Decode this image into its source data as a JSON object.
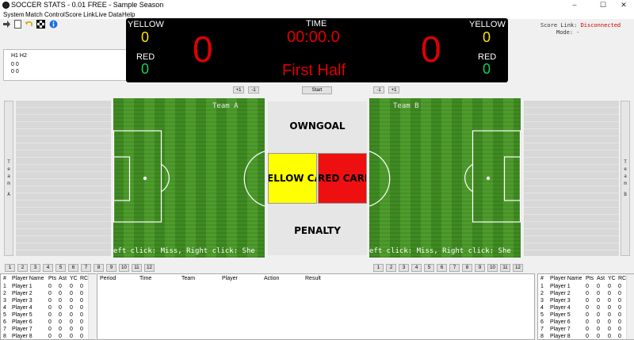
{
  "window": {
    "title": "SOCCER STATS - 0.01 FREE - Sample Season",
    "min": "–",
    "max": "☐",
    "close": "✕"
  },
  "menu": [
    "System",
    "Match Control",
    "Score Link",
    "Live Data",
    "Help"
  ],
  "halves": {
    "header": "H1  H2",
    "row1": "0    0",
    "row2": "0    0"
  },
  "scoreboard": {
    "home": {
      "yellow_label": "YELLOW",
      "yellow": "0",
      "red_label": "RED",
      "red": "0",
      "score": "0"
    },
    "away": {
      "yellow_label": "YELLOW",
      "yellow": "0",
      "red_label": "RED",
      "red": "0",
      "score": "0"
    },
    "time_label": "TIME",
    "time": "00:00.0",
    "period": "First Half"
  },
  "score_link": {
    "label": "Score Link:",
    "status": "Disconnected",
    "mode_label": "Mode:",
    "mode": "-"
  },
  "controls": {
    "plus1": "+1",
    "minus1": "-1",
    "start": "Start"
  },
  "fields": {
    "home_team": "Team A",
    "away_team": "Team B",
    "hint_home": "eft click: Miss, Right click: She",
    "hint_away": "eft click: Miss, Right click: She"
  },
  "side": {
    "home_vertical": [
      "T",
      "e",
      "a",
      "m",
      "",
      "A"
    ],
    "away_vertical": [
      "T",
      "e",
      "a",
      "m",
      "",
      "B"
    ]
  },
  "center_buttons": {
    "owngoal": "OWNGOAL",
    "yellow_card": "ELLOW CAR",
    "red_card": "RED CARD",
    "penalty": "PENALTY"
  },
  "number_buttons": [
    "1",
    "2",
    "3",
    "4",
    "5",
    "6",
    "7",
    "8",
    "9",
    "10",
    "11",
    "12"
  ],
  "player_columns": [
    "#",
    "Player Name",
    "Pts",
    "Ast",
    "YC",
    "RC"
  ],
  "home_players": [
    {
      "n": "1",
      "name": "Player 1",
      "pts": "0",
      "ast": "0",
      "yc": "0",
      "rc": "0"
    },
    {
      "n": "2",
      "name": "Player 2",
      "pts": "0",
      "ast": "0",
      "yc": "0",
      "rc": "0"
    },
    {
      "n": "3",
      "name": "Player 3",
      "pts": "0",
      "ast": "0",
      "yc": "0",
      "rc": "0"
    },
    {
      "n": "4",
      "name": "Player 4",
      "pts": "0",
      "ast": "0",
      "yc": "0",
      "rc": "0"
    },
    {
      "n": "5",
      "name": "Player 5",
      "pts": "0",
      "ast": "0",
      "yc": "0",
      "rc": "0"
    },
    {
      "n": "6",
      "name": "Player 6",
      "pts": "0",
      "ast": "0",
      "yc": "0",
      "rc": "0"
    },
    {
      "n": "7",
      "name": "Player 7",
      "pts": "0",
      "ast": "0",
      "yc": "0",
      "rc": "0"
    },
    {
      "n": "8",
      "name": "Player 8",
      "pts": "0",
      "ast": "0",
      "yc": "0",
      "rc": "0"
    }
  ],
  "away_players": [
    {
      "n": "1",
      "name": "Player 1",
      "pts": "0",
      "ast": "0",
      "yc": "0",
      "rc": "0"
    },
    {
      "n": "2",
      "name": "Player 2",
      "pts": "0",
      "ast": "0",
      "yc": "0",
      "rc": "0"
    },
    {
      "n": "3",
      "name": "Player 3",
      "pts": "0",
      "ast": "0",
      "yc": "0",
      "rc": "0"
    },
    {
      "n": "4",
      "name": "Player 4",
      "pts": "0",
      "ast": "0",
      "yc": "0",
      "rc": "0"
    },
    {
      "n": "5",
      "name": "Player 5",
      "pts": "0",
      "ast": "0",
      "yc": "0",
      "rc": "0"
    },
    {
      "n": "6",
      "name": "Player 6",
      "pts": "0",
      "ast": "0",
      "yc": "0",
      "rc": "0"
    },
    {
      "n": "7",
      "name": "Player 7",
      "pts": "0",
      "ast": "0",
      "yc": "0",
      "rc": "0"
    },
    {
      "n": "8",
      "name": "Player 8",
      "pts": "0",
      "ast": "0",
      "yc": "0",
      "rc": "0"
    }
  ],
  "event_columns": [
    "Period",
    "Time",
    "Team",
    "Player",
    "Action",
    "Result"
  ],
  "toolbar_icons": [
    "arrow-right-icon",
    "blank-page-icon",
    "undo-icon",
    "checkered-flag-icon",
    "info-icon"
  ],
  "colors": {
    "board_bg": "#000000",
    "yellow": "#ffe400",
    "green": "#18d050",
    "red": "#e00000",
    "disconnected": "#cc0000"
  }
}
